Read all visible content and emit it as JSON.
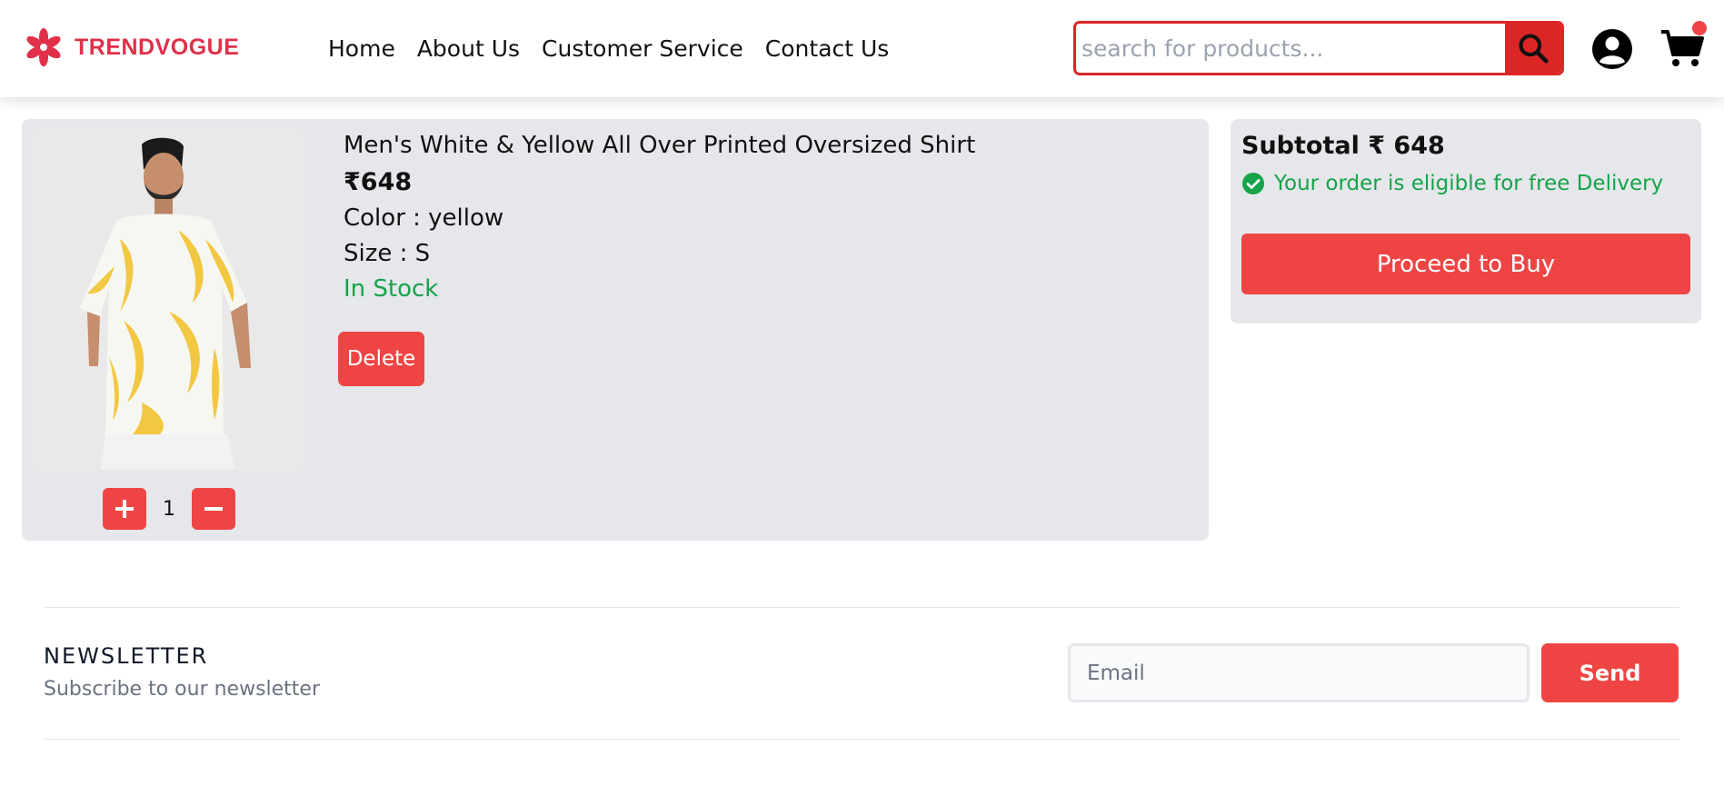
{
  "brand": {
    "name": "TRENDVOGUE",
    "color": "#e0304a"
  },
  "nav": [
    {
      "label": "Home"
    },
    {
      "label": "About Us"
    },
    {
      "label": "Customer Service"
    },
    {
      "label": "Contact Us"
    }
  ],
  "search": {
    "placeholder": "search for products...",
    "value": ""
  },
  "icons": {
    "search": "search-icon",
    "user": "user-circle-icon",
    "cart": "shopping-cart-icon"
  },
  "cart_item": {
    "title": "Men's White & Yellow All Over Printed Oversized Shirt",
    "price": "₹648",
    "color": "Color : yellow",
    "size": "Size : S",
    "stock": "In Stock",
    "delete_label": "Delete",
    "quantity": "1"
  },
  "summary": {
    "subtotal": "Subtotal ₹ 648",
    "eligibility": "Your order is eligible for free Delivery",
    "buy_label": "Proceed to Buy"
  },
  "newsletter": {
    "title": "NEWSLETTER",
    "subtitle": "Subscribe to our newsletter",
    "email_placeholder": "Email",
    "send_label": "Send"
  },
  "colors": {
    "accent": "#ef4444",
    "success": "#16a34a",
    "panel": "#e5e7eb"
  }
}
